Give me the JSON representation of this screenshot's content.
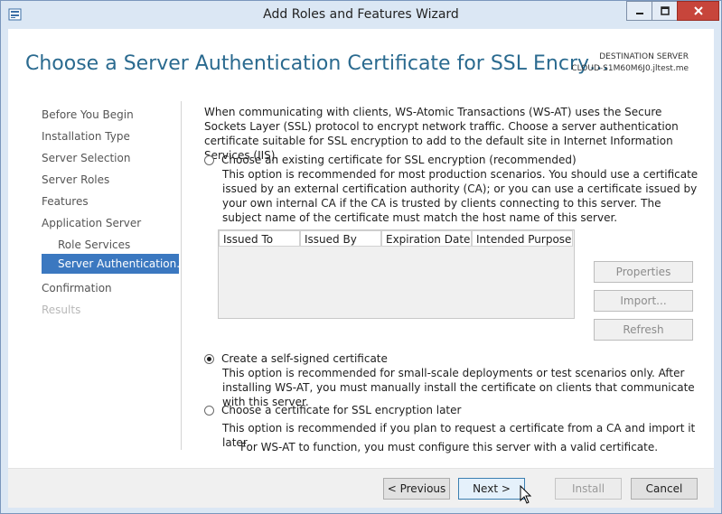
{
  "window": {
    "title": "Add Roles and Features Wizard",
    "icons": {
      "app": "server-manager-icon",
      "minimize": "minimize-icon",
      "maximize": "maximize-icon",
      "close": "close-icon"
    }
  },
  "header": {
    "page_title": "Choose a Server Authentication Certificate for SSL Encry…",
    "destination_label": "DESTINATION SERVER",
    "destination_name": "CLOUD-S1M60M6J0.jltest.me"
  },
  "nav": {
    "items": [
      {
        "label": "Before You Begin",
        "state": "normal"
      },
      {
        "label": "Installation Type",
        "state": "normal"
      },
      {
        "label": "Server Selection",
        "state": "normal"
      },
      {
        "label": "Server Roles",
        "state": "normal"
      },
      {
        "label": "Features",
        "state": "normal"
      },
      {
        "label": "Application Server",
        "state": "normal"
      },
      {
        "label": "Role Services",
        "state": "sub"
      },
      {
        "label": "Server Authentication...",
        "state": "active"
      },
      {
        "label": "Confirmation",
        "state": "normal"
      },
      {
        "label": "Results",
        "state": "disabled"
      }
    ]
  },
  "content": {
    "intro": "When communicating with clients, WS-Atomic Transactions (WS-AT) uses the Secure Sockets Layer (SSL) protocol to encrypt network traffic. Choose a server authentication certificate suitable for SSL encryption to add to the default site in Internet Information Services (IIS).",
    "options": [
      {
        "label": "Choose an existing certificate for SSL encryption (recommended)",
        "description": "This option is recommended for most production scenarios. You should use a certificate issued by an external certification authority (CA); or you can use a certificate issued by your own internal CA if the CA is trusted by clients connecting to this server. The subject name of the certificate must match the host name of this server.",
        "checked": false
      },
      {
        "label": "Create a self-signed certificate",
        "description": "This option is recommended for small-scale deployments or test scenarios only. After installing WS-AT, you must manually install the certificate on clients that communicate with this server.",
        "checked": true
      },
      {
        "label": "Choose a certificate for SSL encryption later",
        "description": "This option is recommended if you plan to request a certificate from a CA and import it later.",
        "checked": false
      }
    ],
    "note": "For WS-AT to function, you must configure this server with a valid certificate.",
    "cert_table": {
      "columns": [
        "Issued To",
        "Issued By",
        "Expiration Date",
        "Intended Purpose"
      ],
      "rows": []
    },
    "cert_buttons": {
      "properties": "Properties",
      "import": "Import...",
      "refresh": "Refresh"
    }
  },
  "footer": {
    "previous": "< Previous",
    "next": "Next >",
    "install": "Install",
    "cancel": "Cancel"
  },
  "colors": {
    "accent_title": "#2a6a8f",
    "nav_active": "#3b78c0",
    "close_button": "#c7453b"
  }
}
